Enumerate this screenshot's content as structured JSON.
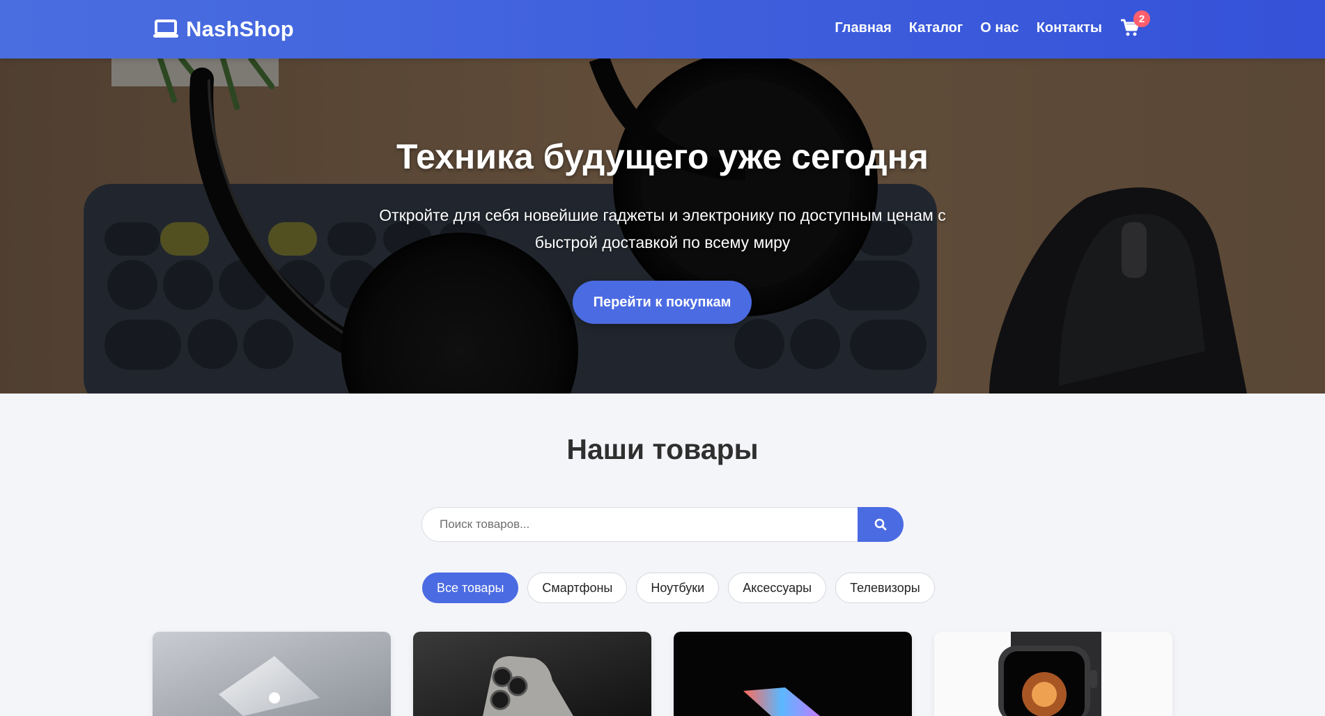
{
  "brand": {
    "name": "NashShop"
  },
  "nav": {
    "items": [
      {
        "label": "Главная"
      },
      {
        "label": "Каталог"
      },
      {
        "label": "О нас"
      },
      {
        "label": "Контакты"
      }
    ],
    "cart_count": "2"
  },
  "hero": {
    "title": "Техника будущего уже сегодня",
    "subtitle": "Откройте для себя новейшие гаджеты и электронику по доступным ценам с быстрой доставкой по всему миру",
    "cta": "Перейти к покупкам"
  },
  "products": {
    "title": "Наши товары",
    "search": {
      "placeholder": "Поиск товаров...",
      "value": ""
    },
    "filters": [
      {
        "label": "Все товары",
        "active": true
      },
      {
        "label": "Смартфоны",
        "active": false
      },
      {
        "label": "Ноутбуки",
        "active": false
      },
      {
        "label": "Аксессуары",
        "active": false
      },
      {
        "label": "Телевизоры",
        "active": false
      }
    ],
    "cards": [
      {
        "image": "laptop-photo"
      },
      {
        "image": "smartphone-photo"
      },
      {
        "image": "laptop-dark-photo"
      },
      {
        "image": "smartwatch-photo"
      }
    ]
  },
  "colors": {
    "primary": "#4b6be2",
    "badge": "#ff5f6d",
    "background": "#f4f5f9"
  }
}
